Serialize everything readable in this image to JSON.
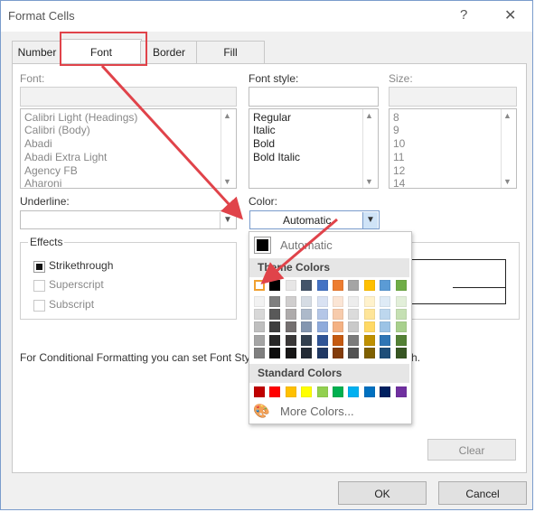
{
  "window": {
    "title": "Format Cells",
    "help_glyph": "?",
    "close_glyph": "✕"
  },
  "tabs": [
    {
      "label": "Number"
    },
    {
      "label": "Font"
    },
    {
      "label": "Border"
    },
    {
      "label": "Fill"
    }
  ],
  "font": {
    "label": "Font:",
    "input_value": "",
    "items": [
      "Calibri Light (Headings)",
      "Calibri (Body)",
      "Abadi",
      "Abadi Extra Light",
      "Agency FB",
      "Aharoni"
    ]
  },
  "font_style": {
    "label": "Font style:",
    "input_value": "",
    "items": [
      "Regular",
      "Italic",
      "Bold",
      "Bold Italic"
    ]
  },
  "size": {
    "label": "Size:",
    "input_value": "",
    "items": [
      "8",
      "9",
      "10",
      "11",
      "12",
      "14"
    ]
  },
  "underline": {
    "label": "Underline:",
    "value": ""
  },
  "color": {
    "label": "Color:",
    "value": "Automatic"
  },
  "effects": {
    "label": "Effects",
    "items": [
      {
        "label": "Strikethrough",
        "checked": true,
        "enabled": true
      },
      {
        "label": "Superscript",
        "checked": false,
        "enabled": false
      },
      {
        "label": "Subscript",
        "checked": false,
        "enabled": false
      }
    ]
  },
  "info_text_left": "For Conditional Formatting you can set Font Style,",
  "info_text_right": "h.",
  "buttons": {
    "clear": "Clear",
    "ok": "OK",
    "cancel": "Cancel"
  },
  "color_popup": {
    "automatic_label": "Automatic",
    "theme_header": "Theme Colors",
    "standard_header": "Standard Colors",
    "more_colors": "More Colors...",
    "theme_top": [
      "#FFFFFF",
      "#000000",
      "#E7E6E6",
      "#44546A",
      "#4472C4",
      "#ED7D31",
      "#A5A5A5",
      "#FFC000",
      "#5B9BD5",
      "#70AD47"
    ],
    "theme_shades": [
      [
        "#F2F2F2",
        "#7F7F7F",
        "#D0CECE",
        "#D6DCE4",
        "#D9E2F3",
        "#FBE5D5",
        "#EDEDED",
        "#FFF2CC",
        "#DEEBF6",
        "#E2EFD9"
      ],
      [
        "#D8D8D8",
        "#595959",
        "#AEABAB",
        "#ADB9CA",
        "#B4C6E7",
        "#F7CBAC",
        "#DBDBDB",
        "#FEE599",
        "#BDD7EE",
        "#C5E0B3"
      ],
      [
        "#BFBFBF",
        "#3F3F3F",
        "#757070",
        "#8496B0",
        "#8EAADB",
        "#F4B183",
        "#C9C9C9",
        "#FFD965",
        "#9CC3E5",
        "#A8D08D"
      ],
      [
        "#A5A5A5",
        "#262626",
        "#3A3838",
        "#323F4F",
        "#2F5496",
        "#C55A11",
        "#7B7B7B",
        "#BF9000",
        "#2E75B5",
        "#538135"
      ],
      [
        "#7F7F7F",
        "#0C0C0C",
        "#171616",
        "#222A35",
        "#1F3864",
        "#833C0B",
        "#525252",
        "#7F6000",
        "#1E4E79",
        "#375623"
      ]
    ],
    "standard": [
      "#C00000",
      "#FF0000",
      "#FFC000",
      "#FFFF00",
      "#92D050",
      "#00B050",
      "#00B0F0",
      "#0070C0",
      "#002060",
      "#7030A0"
    ]
  }
}
